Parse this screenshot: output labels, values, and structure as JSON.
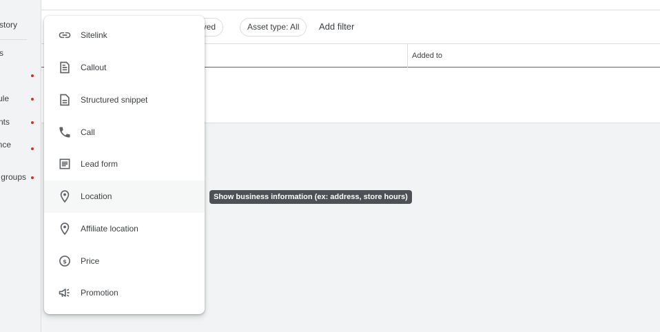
{
  "sidebar": {
    "items": [
      {
        "label": "story",
        "dot": false
      },
      {
        "label": "s",
        "dot": false
      },
      {
        "label": "",
        "dot": true
      },
      {
        "label": "ule",
        "dot": true
      },
      {
        "label": "nts",
        "dot": true
      },
      {
        "label": "nce",
        "dot": true
      },
      {
        "label": "n groups",
        "dot": true
      }
    ]
  },
  "filters": {
    "chip_removed": "moved",
    "chip_asset_type": "Asset type: All",
    "add_filter": "Add filter"
  },
  "table": {
    "col_added_to": "Added to"
  },
  "menu": {
    "items": [
      {
        "label": "Sitelink",
        "icon": "link-icon"
      },
      {
        "label": "Callout",
        "icon": "callout-icon"
      },
      {
        "label": "Structured snippet",
        "icon": "structured-snippet-icon"
      },
      {
        "label": "Call",
        "icon": "phone-icon"
      },
      {
        "label": "Lead form",
        "icon": "lead-form-icon"
      },
      {
        "label": "Location",
        "icon": "location-pin-icon"
      },
      {
        "label": "Affiliate location",
        "icon": "location-pin-icon"
      },
      {
        "label": "Price",
        "icon": "price-icon"
      },
      {
        "label": "Promotion",
        "icon": "megaphone-icon"
      }
    ],
    "hovered_index": 5
  },
  "tooltip": {
    "text": "Show business information (ex: address, store hours)"
  },
  "colors": {
    "accent_dot": "#d93025",
    "tooltip_bg": "#4d5156",
    "icon_gray": "#5f6368"
  }
}
